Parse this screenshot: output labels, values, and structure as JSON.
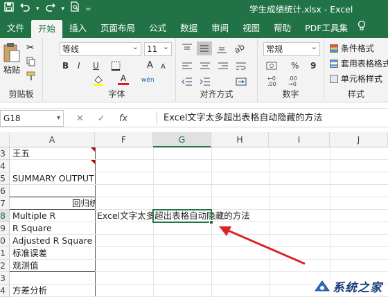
{
  "titlebar": {
    "title": "学生成绩统计.xlsx - Excel",
    "save_icon": "save-icon",
    "undo_icon": "undo-icon",
    "redo_icon": "redo-icon",
    "preview_icon": "print-preview-icon",
    "customize_icon": "customize-quick-access-icon"
  },
  "tabs": [
    "文件",
    "开始",
    "插入",
    "页面布局",
    "公式",
    "数据",
    "审阅",
    "视图",
    "帮助",
    "PDF工具集"
  ],
  "active_tab": "开始",
  "ribbon": {
    "clipboard": {
      "paste_label": "粘贴",
      "group_label": "剪贴板"
    },
    "font": {
      "font_name": "等线",
      "font_size": "11",
      "bold": "B",
      "italic": "I",
      "underline": "U",
      "grow": "A",
      "shrink": "A",
      "font_color_letter": "A",
      "wen": "wén",
      "group_label": "字体"
    },
    "alignment": {
      "group_label": "对齐方式"
    },
    "number": {
      "format": "常规",
      "percent": "%",
      "comma": "9",
      "group_label": "数字"
    },
    "styles": {
      "conditional": "条件格式",
      "table_format": "套用表格格式",
      "cell_styles": "单元格样式",
      "group_label": "样式"
    }
  },
  "formula_bar": {
    "name_box": "G18",
    "cancel": "✕",
    "enter": "✓",
    "fx": "fx",
    "content": "Excel文字太多超出表格自动隐藏的方法"
  },
  "columns": [
    "A",
    "F",
    "G",
    "H",
    "I",
    "J"
  ],
  "selected_column": "G",
  "rows": [
    {
      "num": "3",
      "a": "王五"
    },
    {
      "num": "4",
      "a": ""
    },
    {
      "num": "5",
      "a": "SUMMARY OUTPUT"
    },
    {
      "num": "6",
      "a": ""
    },
    {
      "num": "7",
      "a": "回归统"
    },
    {
      "num": "8",
      "a": "Multiple R"
    },
    {
      "num": "9",
      "a": "R Square"
    },
    {
      "num": "0",
      "a": "Adjusted R Square"
    },
    {
      "num": "1",
      "a": "标准误差"
    },
    {
      "num": "2",
      "a": "观测值"
    },
    {
      "num": "3",
      "a": ""
    },
    {
      "num": "4",
      "a": "方差分析"
    }
  ],
  "overflow_text": "Excel文字太多超出表格自动隐藏的方法",
  "watermark": {
    "text": "系统之家"
  },
  "colors": {
    "excel_green": "#217346",
    "arrow_red": "#d9262c",
    "ribbon_bg": "#f3f3f3"
  }
}
